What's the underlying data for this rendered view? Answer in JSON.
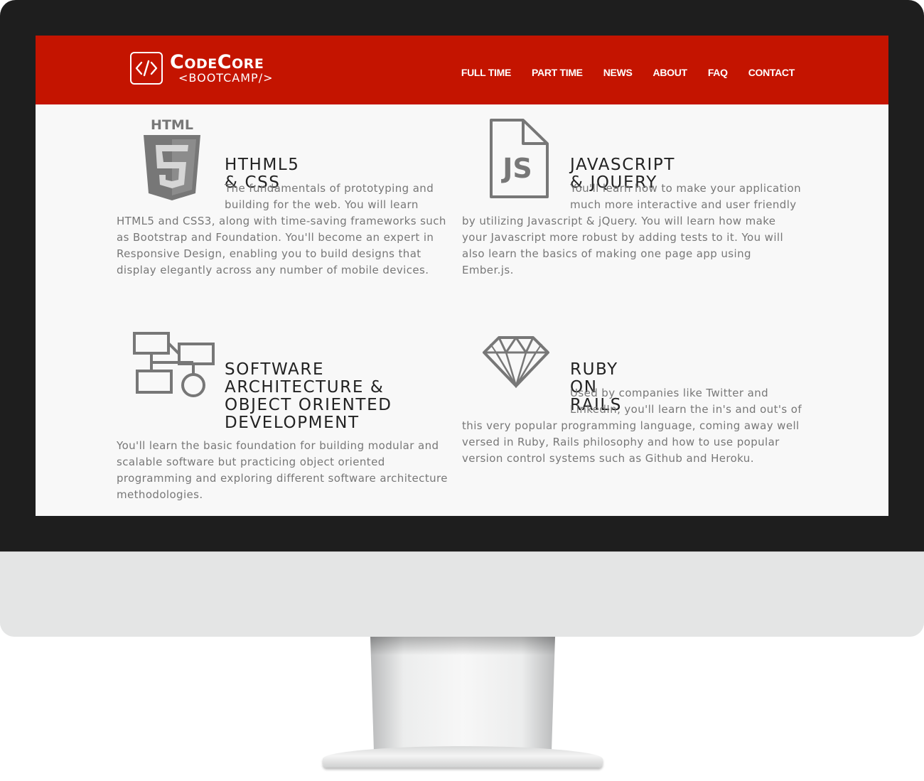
{
  "brand": {
    "name": "CodeCore",
    "subtitle": "<BOOTCAMP/>",
    "mark": "</>",
    "color": "#c41400"
  },
  "nav": {
    "items": [
      {
        "label": "FULL TIME"
      },
      {
        "label": "PART TIME"
      },
      {
        "label": "NEWS"
      },
      {
        "label": "ABOUT"
      },
      {
        "label": "FAQ"
      },
      {
        "label": "CONTACT"
      }
    ]
  },
  "features": [
    {
      "icon": "html5-icon",
      "icon_label": "HTML",
      "title": "HTHML5 & CSS",
      "text": "The fundamentals of prototyping and building for the web. You will learn HTML5 and CSS3, along with time-saving frameworks such as Bootstrap and Foundation. You'll become an expert in Responsive Design, enabling you to build designs that display elegantly across any number of mobile devices."
    },
    {
      "icon": "javascript-file-icon",
      "icon_label": "JS",
      "title": "JAVASCRIPT & JQUERY",
      "text": "You'll learn how to make your application much more interactive and user friendly by utilizing Javascript & jQuery. You will learn how make your Javascript more robust by adding tests to it. You will also learn the basics of making one page app using Ember.js."
    },
    {
      "icon": "architecture-diagram-icon",
      "title": "SOFTWARE ARCHITECTURE & OBJECT ORIENTED DEVELOPMENT",
      "text": "You'll learn the basic foundation for building modular and scalable software but practicing object oriented programming and exploring different software architecture methodologies."
    },
    {
      "icon": "ruby-gem-icon",
      "title": "RUBY ON RAILS",
      "text": "Used by companies like Twitter and LinkedIn, you'll learn the in's and out's of this very popular programming language, coming away well versed in Ruby, Rails philosophy and how to use popular version control systems such as Github and Heroku."
    }
  ]
}
